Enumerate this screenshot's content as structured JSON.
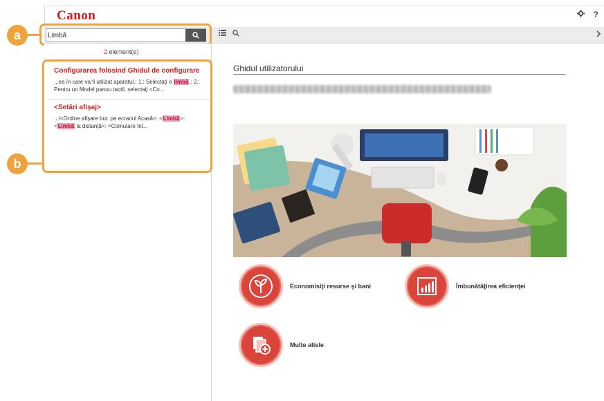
{
  "header": {
    "brand": "Canon"
  },
  "search": {
    "value": "Limbă",
    "button_icon": "search-icon"
  },
  "callouts": {
    "a": "a",
    "b": "b"
  },
  "results_count": {
    "number": "2",
    "suffix": " element(e)"
  },
  "results": [
    {
      "title": "Configurarea folosind Ghidul de configurare",
      "snippet_pre": "...ea în care va fi utilizat aparatul.: 1.: Selectaţi o ",
      "highlight": "limbă",
      "snippet_post": ".: 2.: Pentru un Model panou tactil, selectaţi <Co..."
    },
    {
      "title": "<Setări afişaj>",
      "snippet_pre": ".../<Ordine afişare but. pe ecranul Acasă>: <",
      "highlight": "Limbă",
      "snippet_mid": ">: <",
      "highlight2": "Limbă",
      "snippet_post": " la distanţă>: <Comutare înt..."
    }
  ],
  "main": {
    "title": "Ghidul utilizatorului"
  },
  "features": [
    {
      "label": "Economisiţi resurse şi bani",
      "icon": "plant-icon"
    },
    {
      "label": "Îmbunătăţirea eficienţei",
      "icon": "chart-icon"
    },
    {
      "label": "Multe altele",
      "icon": "documents-icon"
    }
  ],
  "colors": {
    "brand": "#cc1a1a",
    "callout": "#f0a33a",
    "feature": "#d9453a"
  }
}
